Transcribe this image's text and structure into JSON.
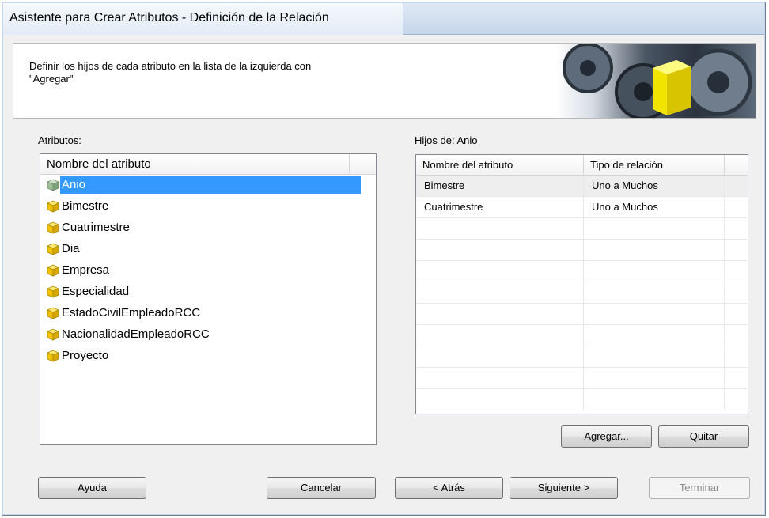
{
  "window": {
    "title": "Asistente para Crear Atributos - Definición de la Relación"
  },
  "header": {
    "description": "Definir los hijos de cada atributo en la lista de la izquierda con\n\"Agregar\""
  },
  "left_panel": {
    "label": "Atributos:",
    "column_header": "Nombre del atributo",
    "items": [
      {
        "label": "Anio",
        "selected": true,
        "icon": "grid-cube-icon"
      },
      {
        "label": "Bimestre",
        "selected": false,
        "icon": "cube-icon"
      },
      {
        "label": "Cuatrimestre",
        "selected": false,
        "icon": "cube-icon"
      },
      {
        "label": "Dia",
        "selected": false,
        "icon": "cube-icon"
      },
      {
        "label": "Empresa",
        "selected": false,
        "icon": "cube-icon"
      },
      {
        "label": "Especialidad",
        "selected": false,
        "icon": "cube-icon"
      },
      {
        "label": "EstadoCivilEmpleadoRCC",
        "selected": false,
        "icon": "cube-icon"
      },
      {
        "label": "NacionalidadEmpleadoRCC",
        "selected": false,
        "icon": "cube-icon"
      },
      {
        "label": "Proyecto",
        "selected": false,
        "icon": "cube-icon"
      }
    ]
  },
  "right_panel": {
    "label": "Hijos de: Anio",
    "columns": [
      "Nombre del atributo",
      "Tipo de relación"
    ],
    "rows": [
      [
        "Bimestre",
        "Uno a Muchos"
      ],
      [
        "Cuatrimestre",
        "Uno a Muchos"
      ],
      [
        "",
        ""
      ],
      [
        "",
        ""
      ],
      [
        "",
        ""
      ],
      [
        "",
        ""
      ],
      [
        "",
        ""
      ],
      [
        "",
        ""
      ],
      [
        "",
        ""
      ],
      [
        "",
        ""
      ],
      [
        "",
        ""
      ]
    ]
  },
  "buttons": {
    "agregar": "Agregar...",
    "quitar": "Quitar",
    "ayuda": "Ayuda",
    "cancelar": "Cancelar",
    "atras": "< Atrás",
    "siguiente": "Siguiente >",
    "terminar": "Terminar"
  },
  "colors": {
    "selection": "#3399ff",
    "cube_yellow": "#f2c200",
    "window_bg": "#f0f0f0"
  }
}
